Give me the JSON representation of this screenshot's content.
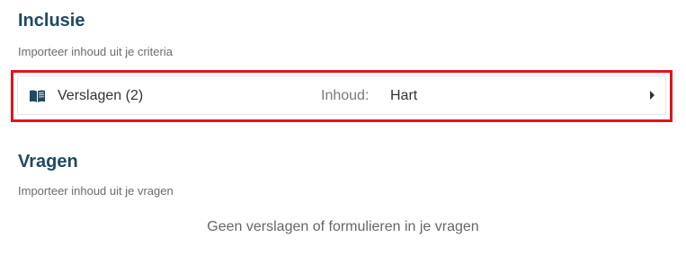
{
  "inclusion": {
    "title": "Inclusie",
    "subtitle": "Importeer inhoud uit je criteria",
    "report_row": {
      "icon": "book-open-icon",
      "label": "Verslagen (2)",
      "content_label": "Inhoud:",
      "content_value": "Hart",
      "chevron_icon": "chevron-right-icon"
    }
  },
  "questions": {
    "title": "Vragen",
    "subtitle": "Importeer inhoud uit je vragen",
    "empty_message": "Geen verslagen of formulieren in je vragen"
  },
  "colors": {
    "heading": "#1f4a63",
    "highlight_border": "#e0141e",
    "icon": "#1f4a63"
  }
}
